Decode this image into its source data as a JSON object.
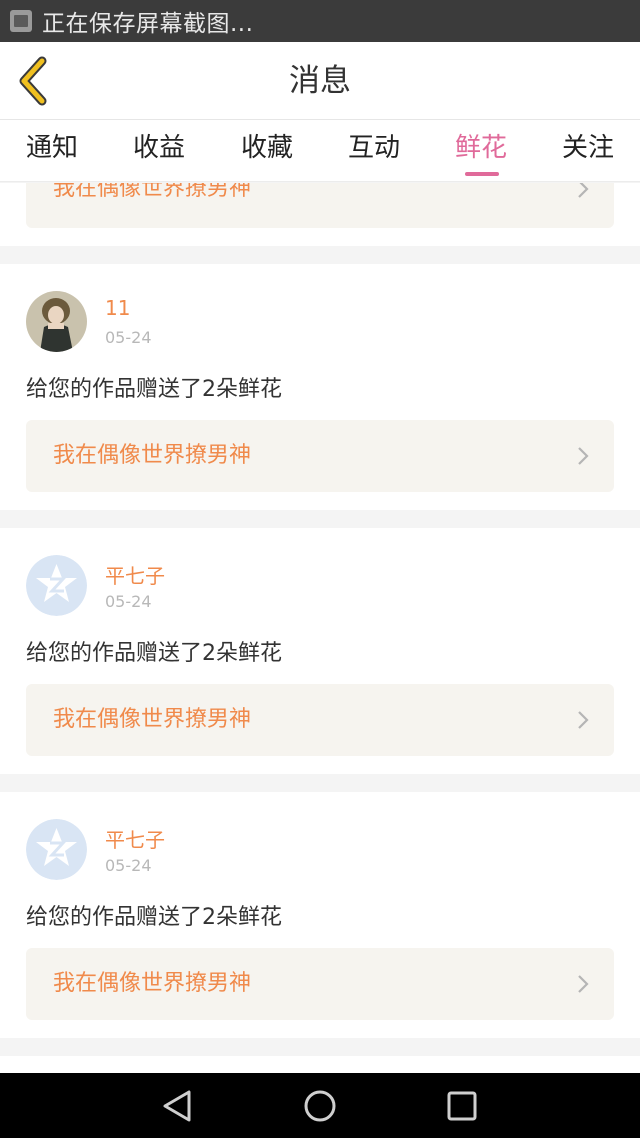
{
  "status_bar": {
    "text": "正在保存屏幕截图..."
  },
  "header": {
    "title": "消息"
  },
  "tabs": [
    {
      "label": "通知"
    },
    {
      "label": "收益"
    },
    {
      "label": "收藏"
    },
    {
      "label": "互动"
    },
    {
      "label": "鲜花",
      "active": true
    },
    {
      "label": "关注"
    }
  ],
  "partial_card": {
    "work_title": "我在偶像世界撩男神"
  },
  "messages": [
    {
      "username": "11",
      "date": "05-24",
      "text": "给您的作品赠送了2朵鲜花",
      "work_title": "我在偶像世界撩男神",
      "avatar": "photo-avatar"
    },
    {
      "username": "平七子",
      "date": "05-24",
      "text": "给您的作品赠送了2朵鲜花",
      "work_title": "我在偶像世界撩男神",
      "avatar": "default-avatar"
    },
    {
      "username": "平七子",
      "date": "05-24",
      "text": "给您的作品赠送了2朵鲜花",
      "work_title": "我在偶像世界撩男神",
      "avatar": "default-avatar"
    }
  ],
  "colors": {
    "accent_pink": "#e06a9a",
    "username_orange": "#f08a4b",
    "link_background": "#f6f4ef",
    "back_arrow": "#f0c020"
  },
  "icons": {
    "back": "chevron-left-icon",
    "row_arrow": "chevron-right-icon",
    "nav_back": "triangle-back-icon",
    "nav_home": "circle-home-icon",
    "nav_recent": "square-recent-icon"
  }
}
